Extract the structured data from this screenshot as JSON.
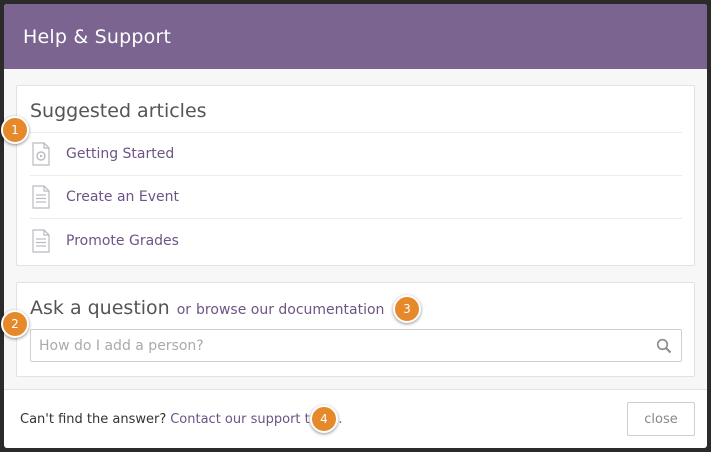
{
  "modal": {
    "title": "Help & Support"
  },
  "articles": {
    "heading": "Suggested articles",
    "items": [
      {
        "label": "Getting Started",
        "icon": "video-doc-icon"
      },
      {
        "label": "Create an Event",
        "icon": "document-icon"
      },
      {
        "label": "Promote Grades",
        "icon": "document-icon"
      }
    ]
  },
  "ask": {
    "title": "Ask a question",
    "or_text": "or",
    "browse_link": "browse our documentation",
    "search_placeholder": "How do I add a person?",
    "search_value": ""
  },
  "footer": {
    "text": "Can't find the answer?",
    "link": "Contact our support team.",
    "close_label": "close"
  },
  "callouts": [
    "1",
    "2",
    "3",
    "4"
  ],
  "colors": {
    "header": "#7b6490",
    "link": "#6d5484",
    "callout": "#e5892a"
  }
}
